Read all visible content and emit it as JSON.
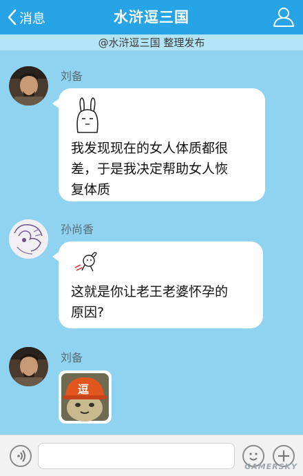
{
  "nav": {
    "back_label": "消息",
    "title": "水浒逗三国",
    "back_icon": "chevron-left-icon",
    "right_icon": "people-icon"
  },
  "subtitle": "@水浒逗三国  整理发布",
  "messages": [
    {
      "sender": "刘备",
      "avatar": "liubei-avatar",
      "sticker": "rabbit-sticker",
      "lines": [
        "我发现现在的女人体质都很",
        "差，于是我决定帮助女人恢",
        "复体质"
      ]
    },
    {
      "sender": "孙尚香",
      "avatar": "sunshangxiang-avatar",
      "sticker": "running-rabbit-sticker",
      "lines": [
        "这就是你让老王老婆怀孕的",
        "原因?"
      ]
    },
    {
      "sender": "刘备",
      "avatar": "liubei-avatar",
      "image": "hardhat-cat-image",
      "image_text": "逗"
    }
  ],
  "bottom": {
    "voice_icon": "voice-icon",
    "emoji_icon": "emoji-icon",
    "plus_icon": "plus-icon"
  },
  "watermark": "GAMERSKY",
  "colors": {
    "nav_bg": "#27a4e6",
    "chat_bg": "#8fd3f0",
    "bubble": "#ffffff"
  }
}
